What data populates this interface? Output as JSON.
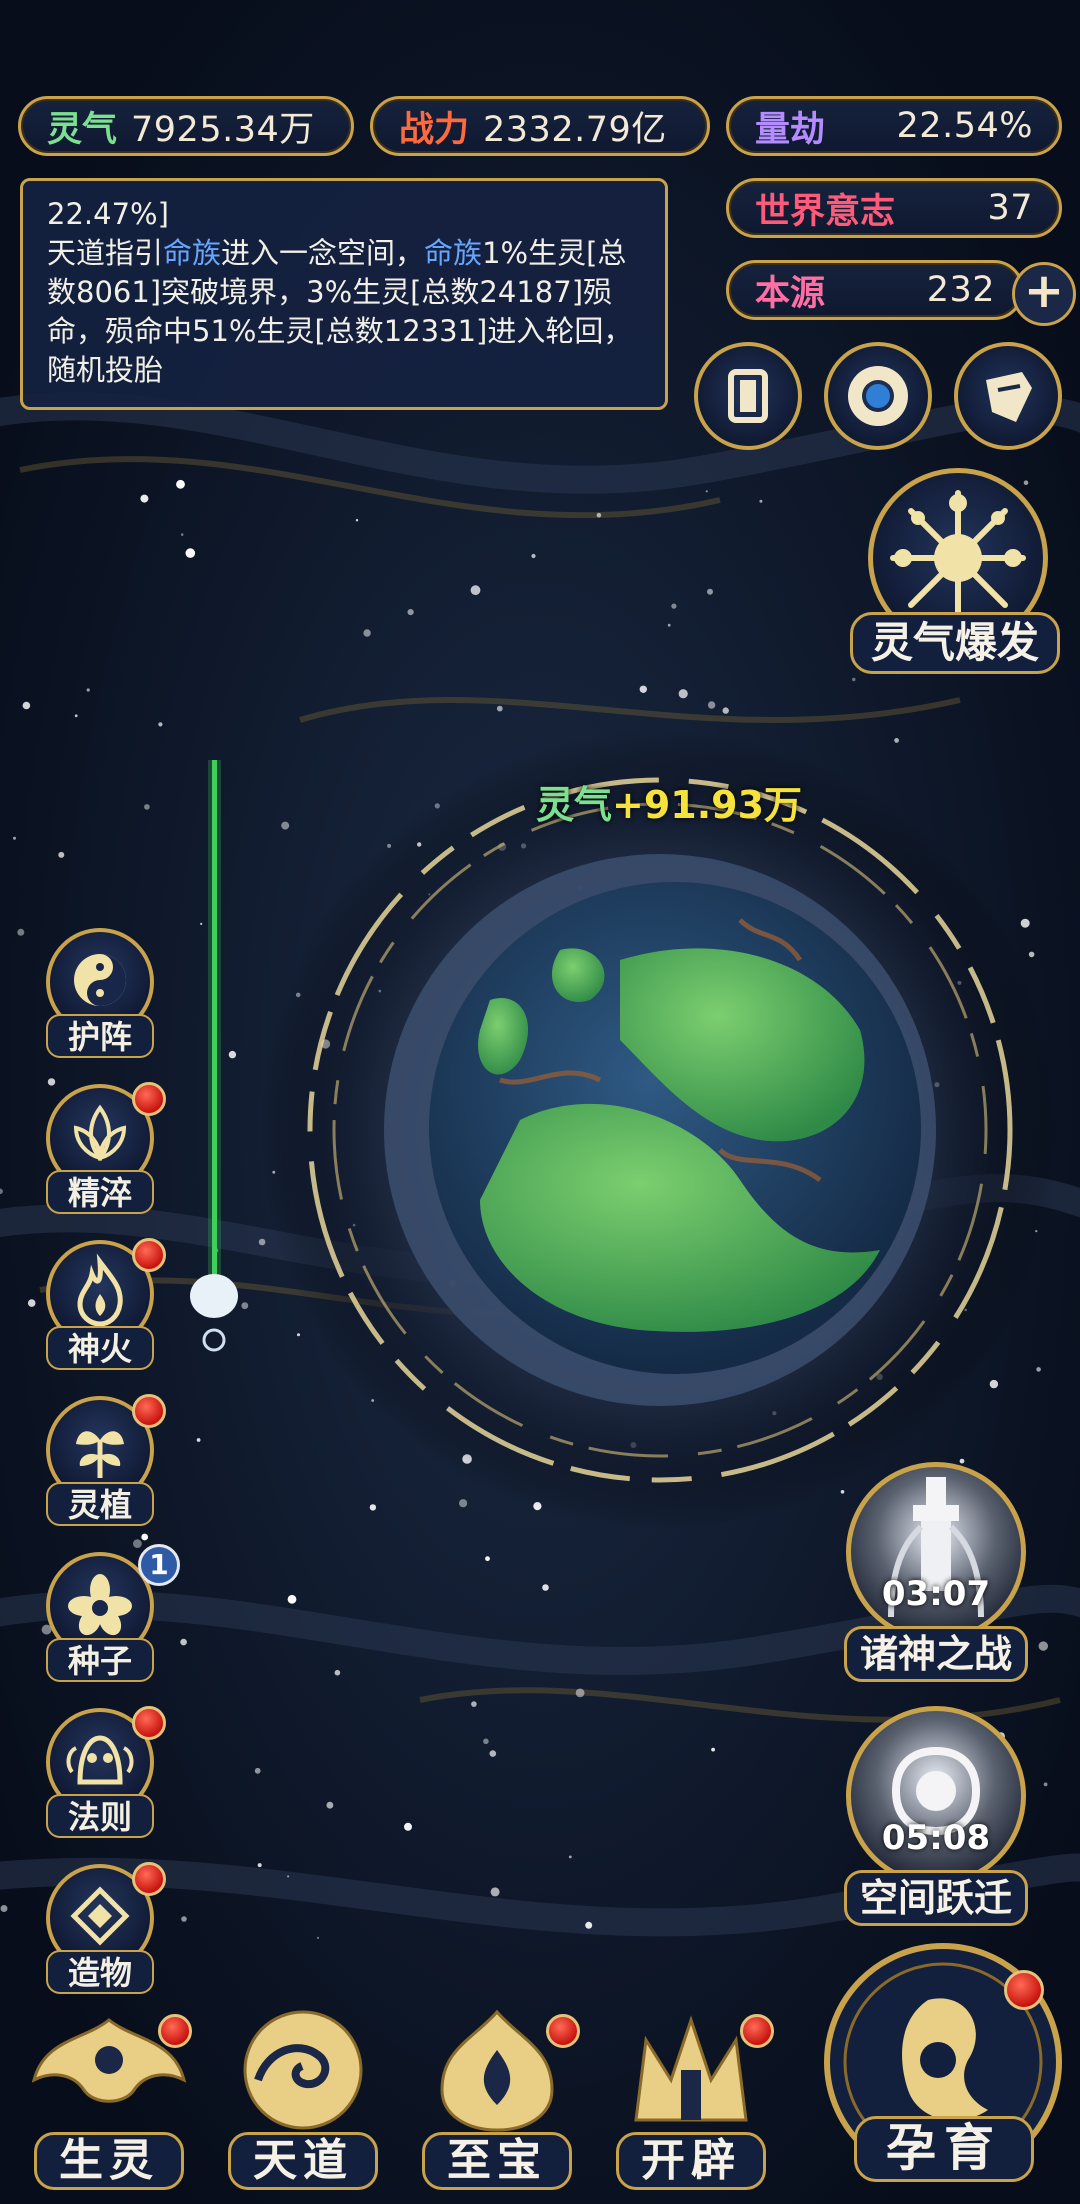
{
  "stats": {
    "lingqi": {
      "label": "灵气",
      "value": "7925.34万"
    },
    "zhanli": {
      "label": "战力",
      "value": "2332.79亿"
    },
    "liangjie": {
      "label": "量劫",
      "value": "22.54%"
    },
    "shijie_yizhi": {
      "label": "世界意志",
      "value": "37"
    },
    "benyuan": {
      "label": "本源",
      "value": "232",
      "add": "+"
    }
  },
  "log": {
    "line1": "22.47%]",
    "seg1": "天道指引",
    "seg2": "命族",
    "seg3": "进入一念空间，",
    "seg4": "命族",
    "seg5": "1%生灵[总数8061]突破境界，3%生灵[总数24187]殒命，殒命中51%生灵[总数12331]进入轮回，随机投胎"
  },
  "gain": {
    "label": "灵气",
    "value": "+91.93万"
  },
  "burst": {
    "label": "灵气爆发"
  },
  "side_buttons": [
    {
      "label": "护阵",
      "dot": false
    },
    {
      "label": "精淬",
      "dot": true
    },
    {
      "label": "神火",
      "dot": true
    },
    {
      "label": "灵植",
      "dot": true
    },
    {
      "label": "种子",
      "badge": "1"
    },
    {
      "label": "法则",
      "dot": true
    },
    {
      "label": "造物",
      "dot": true
    }
  ],
  "timers": [
    {
      "label": "诸神之战",
      "time": "03:07"
    },
    {
      "label": "空间跃迁",
      "time": "05:08"
    }
  ],
  "nav": [
    {
      "label": "生灵"
    },
    {
      "label": "天道"
    },
    {
      "label": "至宝"
    },
    {
      "label": "开辟"
    }
  ],
  "main_action": {
    "label": "孕育"
  },
  "colors": {
    "gold": "#c9a24c",
    "panel": "#13203d",
    "red_dot": "#c8140f",
    "highlight_blue": "#67a6ff",
    "gain_yellow": "#f5e23c"
  }
}
